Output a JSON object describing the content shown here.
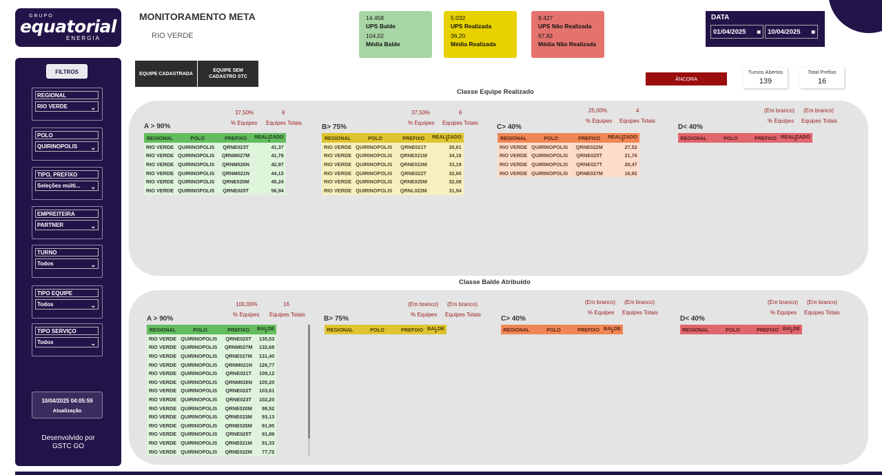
{
  "logo": {
    "group": "GRUPO",
    "brand": "equatorial",
    "energy": "ENERGIA"
  },
  "sidebar": {
    "filters_label": "FILTROS",
    "filters": [
      {
        "title": "REGIONAL",
        "value": "RIO VERDE"
      },
      {
        "title": "POLO",
        "value": "QUIRINOPOLIS"
      },
      {
        "title": "TIPO, PREFIXO",
        "value": "Seleções múlti..."
      },
      {
        "title": "EMPREITEIRA",
        "value": "PARTNER"
      },
      {
        "title": "TURNO",
        "value": "Todos"
      },
      {
        "title": "TIPO EQUIPE",
        "value": "Todos"
      },
      {
        "title": "TIPO SERVIÇO",
        "value": "Todos"
      }
    ],
    "update_datetime": "10/04/2025 04:05:59",
    "update_label": "Atualização",
    "developed_by": "Desenvolvido por",
    "developer": "GSTC GO"
  },
  "header": {
    "title": "MONITORAMENTO META",
    "subtitle": "RIO VERDE"
  },
  "kpis": {
    "green": {
      "value1": "14.458",
      "label1": "UPS Balde",
      "value2": "104,02",
      "label2": "Média Balde"
    },
    "yellow": {
      "value1": "5.032",
      "label1": "UPS Realizada",
      "value2": "36,20",
      "label2": "Média Realizada"
    },
    "red": {
      "value1": "9.427",
      "label1": "UPS Não Realizada",
      "value2": "67,82",
      "label2": "Média Não Realizada"
    }
  },
  "date": {
    "label": "DATA",
    "start": "01/04/2025",
    "end": "10/04/2025"
  },
  "buttons": {
    "registered": "EQUIPE CADASTRADA",
    "unregistered_1": "EQUIPE SEM",
    "unregistered_2": "CADASTRO STC",
    "ancora": "ÂNCORA"
  },
  "stats": {
    "turnos_label": "Turnos Abertos",
    "turnos_value": "139",
    "prefixo_label": "Total Prefixo",
    "prefixo_value": "16"
  },
  "realizado": {
    "title": "Classe Equipe Realizado",
    "groups": [
      {
        "class": "A > 90%",
        "pct": "37,50%",
        "total": "6",
        "pct_label": "% Equipes",
        "total_label": "Equipes Totais",
        "headers": [
          "REGIONAL",
          "POLO",
          "PREFIXO",
          "REALIZADO"
        ],
        "rows": [
          [
            "RIO VERDE",
            "QUIRINOPOLIS",
            "QRNE023T",
            "41,37"
          ],
          [
            "RIO VERDE",
            "QUIRINOPOLIS",
            "QRNM027M",
            "41,78"
          ],
          [
            "RIO VERDE",
            "QUIRINOPOLIS",
            "QRNM026N",
            "42,97"
          ],
          [
            "RIO VERDE",
            "QUIRINOPOLIS",
            "QRNM021N",
            "44,13"
          ],
          [
            "RIO VERDE",
            "QUIRINOPOLIS",
            "QRNE020M",
            "45,24"
          ],
          [
            "RIO VERDE",
            "QUIRINOPOLIS",
            "QRNE020T",
            "56,94"
          ]
        ]
      },
      {
        "class": "B> 75%",
        "pct": "37,50%",
        "total": "6",
        "pct_label": "% Equipes",
        "total_label": "Equipes Totais",
        "headers": [
          "REGIONAL",
          "POLO",
          "PREFIXO",
          "REALIZADO"
        ],
        "rows": [
          [
            "RIO VERDE",
            "QUIRINOPOLIS",
            "QRNE021T",
            "35,61"
          ],
          [
            "RIO VERDE",
            "QUIRINOPOLIS",
            "QRNE021M",
            "34,18"
          ],
          [
            "RIO VERDE",
            "QUIRINOPOLIS",
            "QRNE023M",
            "33,19"
          ],
          [
            "RIO VERDE",
            "QUIRINOPOLIS",
            "QRNE022T",
            "32,60"
          ],
          [
            "RIO VERDE",
            "QUIRINOPOLIS",
            "QRNE025M",
            "32,08"
          ],
          [
            "RIO VERDE",
            "QUIRINOPOLIS",
            "QRNL022M",
            "31,94"
          ]
        ]
      },
      {
        "class": "C> 40%",
        "pct": "25,00%",
        "total": "4",
        "pct_label": "% Equipes",
        "total_label": "Equipes Totais",
        "headers": [
          "REGIONAL",
          "POLO",
          "PREFIXO",
          "REALIZADO"
        ],
        "rows": [
          [
            "RIO VERDE",
            "QUIRINOPOLIS",
            "QRNE022M",
            "27,52"
          ],
          [
            "RIO VERDE",
            "QUIRINOPOLIS",
            "QRNE025T",
            "21,76"
          ],
          [
            "RIO VERDE",
            "QUIRINOPOLIS",
            "QRNE027T",
            "20,47"
          ],
          [
            "RIO VERDE",
            "QUIRINOPOLIS",
            "QRNE027M",
            "16,92"
          ]
        ]
      },
      {
        "class": "D< 40%",
        "pct": "(Em branco)",
        "total": "(Em branco)",
        "pct_label": "% Equipes",
        "total_label": "Equipes Totais",
        "headers": [
          "REGIONAL",
          "POLO",
          "PREFIXO",
          "REALIZADO"
        ],
        "rows": []
      }
    ]
  },
  "balde": {
    "title": "Classe Balde Atribuído",
    "groups": [
      {
        "class": "A > 90%",
        "pct": "100,00%",
        "total": "16",
        "pct_label": "% Equipes",
        "total_label": "Equipes Totais",
        "headers": [
          "REGIONAL",
          "POLO",
          "PREFIXO",
          "BALDE"
        ],
        "rows": [
          [
            "RIO VERDE",
            "QUIRINOPOLIS",
            "QRNE020T",
            "135,53"
          ],
          [
            "RIO VERDE",
            "QUIRINOPOLIS",
            "QRNM027M",
            "132,68"
          ],
          [
            "RIO VERDE",
            "QUIRINOPOLIS",
            "QRNE027M",
            "131,40"
          ],
          [
            "RIO VERDE",
            "QUIRINOPOLIS",
            "QRNM021N",
            "126,77"
          ],
          [
            "RIO VERDE",
            "QUIRINOPOLIS",
            "QRNE021T",
            "109,12"
          ],
          [
            "RIO VERDE",
            "QUIRINOPOLIS",
            "QRNM026N",
            "105,20"
          ],
          [
            "RIO VERDE",
            "QUIRINOPOLIS",
            "QRNE022T",
            "103,61"
          ],
          [
            "RIO VERDE",
            "QUIRINOPOLIS",
            "QRNE023T",
            "102,20"
          ],
          [
            "RIO VERDE",
            "QUIRINOPOLIS",
            "QRNE020M",
            "98,52"
          ],
          [
            "RIO VERDE",
            "QUIRINOPOLIS",
            "QRNE023M",
            "93,13"
          ],
          [
            "RIO VERDE",
            "QUIRINOPOLIS",
            "QRNE025M",
            "91,95"
          ],
          [
            "RIO VERDE",
            "QUIRINOPOLIS",
            "QRNE025T",
            "91,89"
          ],
          [
            "RIO VERDE",
            "QUIRINOPOLIS",
            "QRNE021M",
            "91,33"
          ],
          [
            "RIO VERDE",
            "QUIRINOPOLIS",
            "QRNE022M",
            "77,72"
          ]
        ]
      },
      {
        "class": "B> 75%",
        "pct": "(Em branco)",
        "total": "(Em branco)",
        "pct_label": "% Equipes",
        "total_label": "Equipes Totais",
        "headers": [
          "REGIONAL",
          "POLO",
          "PREFIXO",
          "BALDE"
        ],
        "rows": []
      },
      {
        "class": "C> 40%",
        "pct": "(Em branco)",
        "total": "(Em branco)",
        "pct_label": "% Equipes",
        "total_label": "Equipes Totais",
        "headers": [
          "REGIONAL",
          "POLO",
          "PREFIXO",
          "BALDE"
        ],
        "rows": []
      },
      {
        "class": "D< 40%",
        "pct": "(Em branco)",
        "total": "(Em branco)",
        "pct_label": "% Equipes",
        "total_label": "Equipes Totais",
        "headers": [
          "REGIONAL",
          "POLO",
          "PREFIXO",
          "BALDE"
        ],
        "rows": []
      }
    ]
  },
  "icons": {
    "dropdown": "chevron-down-icon",
    "calendar": "calendar-icon",
    "sort": "sort-desc-icon"
  },
  "colors": {
    "brand": "#221448",
    "class_a": "#63bc5e",
    "class_b": "#ddc430",
    "class_c": "#f08656",
    "class_d": "#e0666d",
    "ancora": "#9b0e0e",
    "pct_text": "#9b1b1b"
  }
}
